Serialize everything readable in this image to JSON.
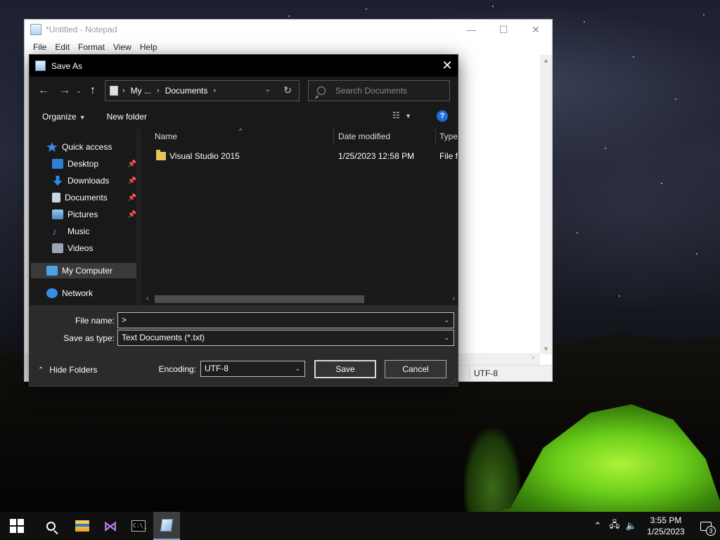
{
  "notepad": {
    "title": "*Untitled - Notepad",
    "menu": [
      "File",
      "Edit",
      "Format",
      "View",
      "Help"
    ],
    "status_encoding": "UTF-8",
    "caption_minimize": "—",
    "caption_maximize": "☐",
    "caption_close": "✕"
  },
  "dialog": {
    "title": "Save As",
    "close_glyph": "✕",
    "nav": {
      "back": "←",
      "forward": "→",
      "recent": "⌄",
      "up": "↑"
    },
    "address": {
      "segments": [
        "My ...",
        "Documents"
      ],
      "separator": "›",
      "dropdown": "⌄",
      "refresh": "↻"
    },
    "search_placeholder": "Search Documents",
    "toolbar": {
      "organize": "Organize",
      "new_folder": "New folder",
      "help_glyph": "?"
    },
    "sidebar": {
      "items": [
        {
          "label": "Quick access",
          "icon": "star-icon",
          "color": "#3b8be6",
          "pinned": false
        },
        {
          "label": "Desktop",
          "icon": "desktop-icon",
          "color": "#2f7fd6",
          "pinned": true
        },
        {
          "label": "Downloads",
          "icon": "download-icon",
          "color": "#2f8ae6",
          "pinned": true
        },
        {
          "label": "Documents",
          "icon": "document-icon",
          "color": "#c9d6e6",
          "pinned": true
        },
        {
          "label": "Pictures",
          "icon": "pictures-icon",
          "color": "#6aa7e6",
          "pinned": true
        },
        {
          "label": "Music",
          "icon": "music-icon",
          "color": "#3b8be6",
          "pinned": false
        },
        {
          "label": "Videos",
          "icon": "videos-icon",
          "color": "#9aa4b2",
          "pinned": false
        },
        {
          "label": "My Computer",
          "icon": "computer-icon",
          "color": "#4aa3e6",
          "pinned": false
        },
        {
          "label": "Network",
          "icon": "network-icon",
          "color": "#3b8be6",
          "pinned": false
        }
      ],
      "pin_glyph": "📌"
    },
    "columns": [
      "Name",
      "Date modified",
      "Type"
    ],
    "files": [
      {
        "name": "Visual Studio 2015",
        "date": "1/25/2023 12:58 PM",
        "type": "File fo"
      }
    ],
    "form": {
      "file_name_label": "File name:",
      "file_name_value": ">",
      "save_type_label": "Save as type:",
      "save_type_value": "Text Documents (*.txt)",
      "encoding_label": "Encoding:",
      "encoding_value": "UTF-8",
      "dropdown_glyph": "⌄",
      "hide_folders": "Hide Folders",
      "save_button": "Save",
      "cancel_button": "Cancel"
    }
  },
  "taskbar": {
    "apps": [
      "start",
      "search",
      "file-explorer",
      "visual-studio",
      "command-prompt",
      "notepad"
    ],
    "time": "3:55 PM",
    "date": "1/25/2023",
    "notification_count": "3"
  },
  "colors": {
    "dialog_bg": "#2b2b2b",
    "pane_bg": "#191919",
    "accent_help": "#1e6fd9",
    "tent_green": "#6fd81a"
  }
}
